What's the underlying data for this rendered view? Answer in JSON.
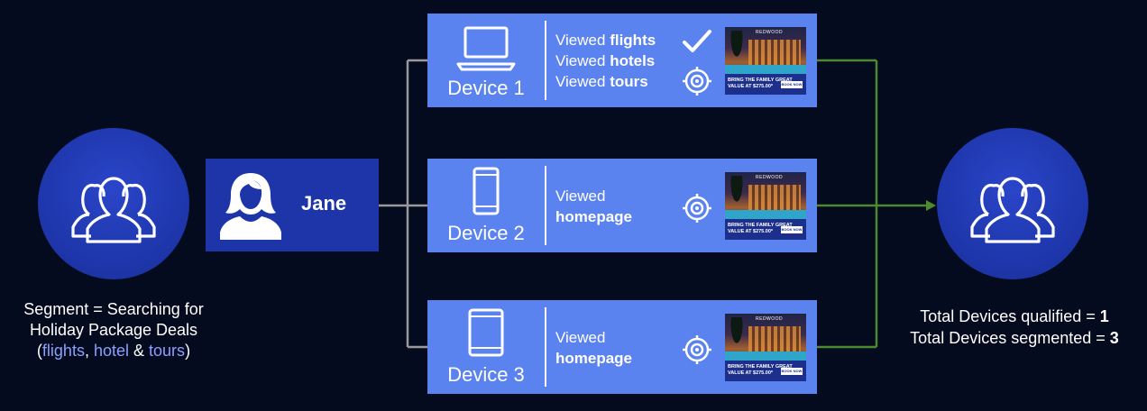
{
  "segment": {
    "caption_line1": "Segment = Searching for",
    "caption_line2": "Holiday Package Deals",
    "open_paren": "(",
    "kw_flights": "flights",
    "sep1": ", ",
    "kw_hotel": "hotel",
    "sep2": " & ",
    "kw_tours": "tours",
    "close_paren": ")",
    "icon": "people-group-icon"
  },
  "person": {
    "name": "Jane",
    "icon": "woman-avatar-icon"
  },
  "devices": [
    {
      "label": "Device 1",
      "icon": "laptop-icon",
      "views": [
        {
          "prefix": "Viewed ",
          "item": "flights"
        },
        {
          "prefix": "Viewed ",
          "item": "hotels"
        },
        {
          "prefix": "Viewed ",
          "item": "tours"
        }
      ],
      "qualified": true,
      "ad": {
        "brand": "REDWOOD",
        "line1": "BRING THE FAMILY GREAT",
        "line2": "VALUE AT $275.00*",
        "cta": "BOOK NOW"
      }
    },
    {
      "label": "Device 2",
      "icon": "phone-icon",
      "views": [
        {
          "prefix": "Viewed",
          "item": ""
        },
        {
          "prefix": "",
          "item": "homepage"
        }
      ],
      "qualified": false,
      "ad": {
        "brand": "REDWOOD",
        "line1": "BRING THE FAMILY GREAT",
        "line2": "VALUE AT $275.00*",
        "cta": "BOOK NOW"
      }
    },
    {
      "label": "Device 3",
      "icon": "tablet-icon",
      "views": [
        {
          "prefix": "Viewed",
          "item": ""
        },
        {
          "prefix": "",
          "item": "homepage"
        }
      ],
      "qualified": false,
      "ad": {
        "brand": "REDWOOD",
        "line1": "BRING THE FAMILY GREAT",
        "line2": "VALUE AT $275.00*",
        "cta": "BOOK NOW"
      }
    }
  ],
  "totals": {
    "qualified_label": "Total Devices qualified = ",
    "qualified_value": "1",
    "segmented_label": "Total Devices segmented = ",
    "segmented_value": "3"
  },
  "colors": {
    "background": "#050b1f",
    "circle": "#1d35a8",
    "device_box": "#5b83ef",
    "person_box": "#1d35a8",
    "highlight_text": "#8aa0ff",
    "gray_connector": "#9a9a9a",
    "green_connector": "#4c8a2f"
  }
}
